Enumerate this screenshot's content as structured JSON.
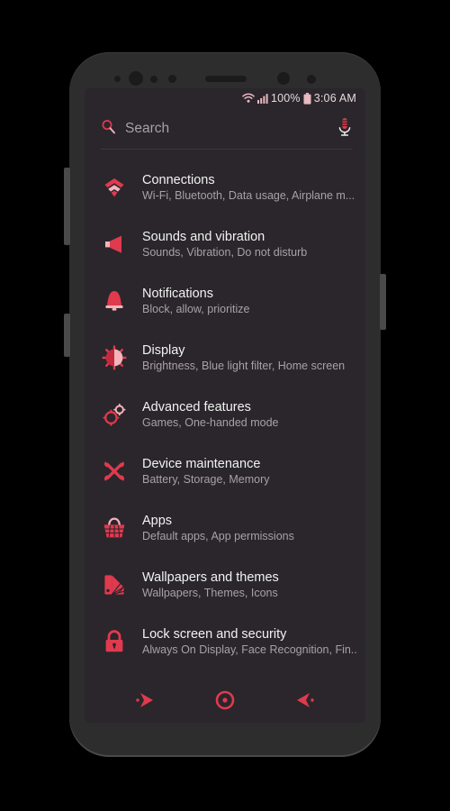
{
  "theme": {
    "accent": "#e03a4e",
    "accent_light": "#f3b3bb",
    "screen_bg": "#2a262b",
    "title_color": "#f2f2f2",
    "subtitle_color": "#a9a1a5"
  },
  "status_bar": {
    "wifi_icon": "wifi-icon",
    "signal_icon": "cellular-signal-icon",
    "battery_percent": "100%",
    "battery_icon": "battery-full-icon",
    "time": "3:06 AM"
  },
  "search": {
    "icon": "search-icon",
    "placeholder": "Search",
    "value": "",
    "mic_icon": "microphone-icon"
  },
  "settings_list": [
    {
      "icon": "connections-icon",
      "title": "Connections",
      "subtitle": "Wi-Fi, Bluetooth, Data usage, Airplane m..."
    },
    {
      "icon": "sound-speaker-icon",
      "title": "Sounds and vibration",
      "subtitle": "Sounds, Vibration, Do not disturb"
    },
    {
      "icon": "notification-bell-icon",
      "title": "Notifications",
      "subtitle": "Block, allow, prioritize"
    },
    {
      "icon": "display-brightness-icon",
      "title": "Display",
      "subtitle": "Brightness, Blue light filter, Home screen"
    },
    {
      "icon": "gears-icon",
      "title": "Advanced features",
      "subtitle": "Games, One-handed mode"
    },
    {
      "icon": "tools-wrench-screwdriver-icon",
      "title": "Device maintenance",
      "subtitle": "Battery, Storage, Memory"
    },
    {
      "icon": "apps-basket-icon",
      "title": "Apps",
      "subtitle": "Default apps, App permissions"
    },
    {
      "icon": "wallpaper-swatch-icon",
      "title": "Wallpapers and themes",
      "subtitle": "Wallpapers, Themes, Icons"
    },
    {
      "icon": "lock-padlock-icon",
      "title": "Lock screen and security",
      "subtitle": "Always On Display, Face Recognition, Fin..."
    }
  ],
  "nav_bar": {
    "recents": "recents-arrow-icon",
    "home": "home-circle-icon",
    "back": "back-arrow-icon"
  }
}
